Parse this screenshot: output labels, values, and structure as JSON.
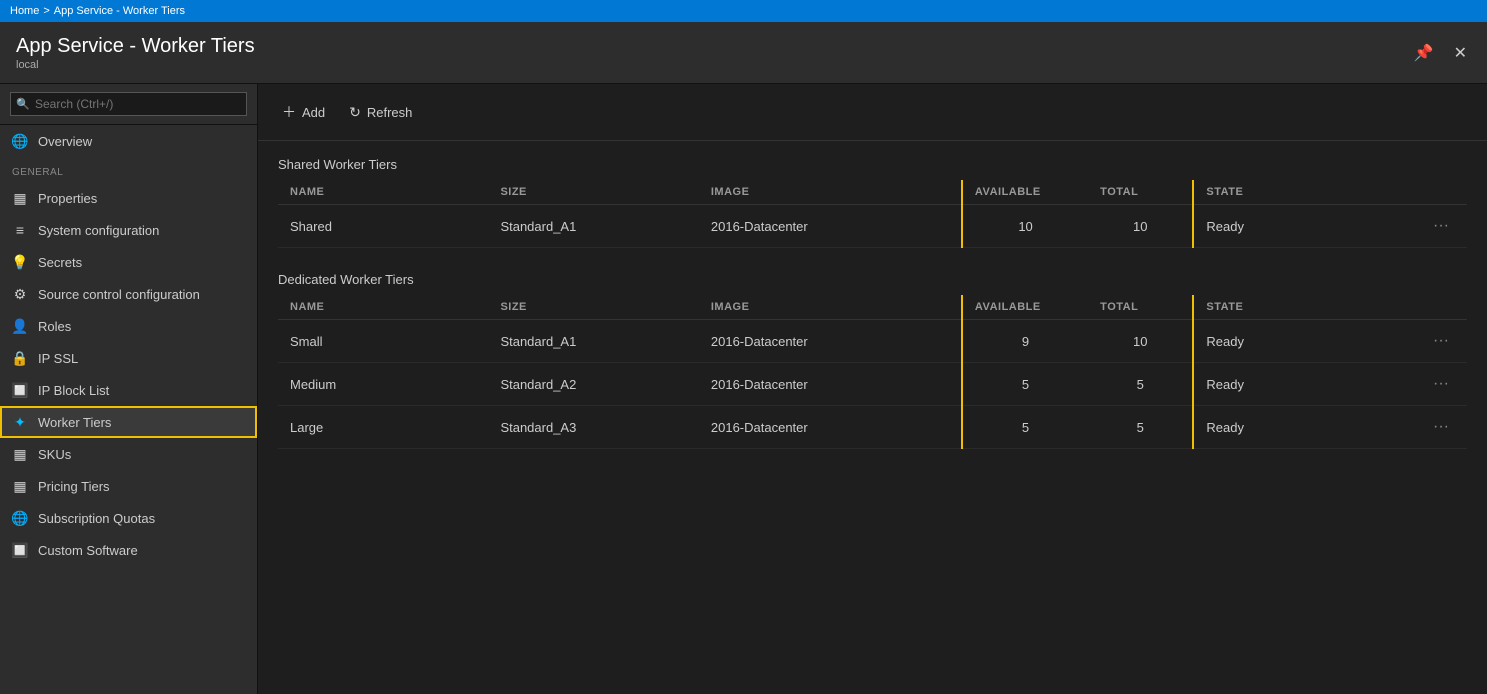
{
  "topbar": {
    "home": "Home",
    "separator": ">",
    "current": "App Service - Worker Tiers"
  },
  "titlebar": {
    "title": "App Service - Worker Tiers",
    "subtitle": "local",
    "pin_label": "📌",
    "close_label": "✕"
  },
  "sidebar": {
    "search_placeholder": "Search (Ctrl+/)",
    "section_general": "GENERAL",
    "items": [
      {
        "id": "overview",
        "label": "Overview",
        "icon": "🌐"
      },
      {
        "id": "properties",
        "label": "Properties",
        "icon": "▦"
      },
      {
        "id": "system-configuration",
        "label": "System configuration",
        "icon": "≡"
      },
      {
        "id": "secrets",
        "label": "Secrets",
        "icon": "💡"
      },
      {
        "id": "source-control",
        "label": "Source control configuration",
        "icon": "⚙"
      },
      {
        "id": "roles",
        "label": "Roles",
        "icon": "👤"
      },
      {
        "id": "ip-ssl",
        "label": "IP SSL",
        "icon": "🔒"
      },
      {
        "id": "ip-block-list",
        "label": "IP Block List",
        "icon": "🔲"
      },
      {
        "id": "worker-tiers",
        "label": "Worker Tiers",
        "icon": "✦",
        "active": true
      },
      {
        "id": "skus",
        "label": "SKUs",
        "icon": "▦"
      },
      {
        "id": "pricing-tiers",
        "label": "Pricing Tiers",
        "icon": "▦"
      },
      {
        "id": "subscription-quotas",
        "label": "Subscription Quotas",
        "icon": "🌐"
      },
      {
        "id": "custom-software",
        "label": "Custom Software",
        "icon": "🔲"
      }
    ]
  },
  "toolbar": {
    "add_label": "Add",
    "refresh_label": "Refresh"
  },
  "shared_section": {
    "title": "Shared Worker Tiers",
    "columns": {
      "name": "NAME",
      "size": "SIZE",
      "image": "IMAGE",
      "available": "AVAILABLE",
      "total": "TOTAL",
      "state": "STATE"
    },
    "rows": [
      {
        "name": "Shared",
        "size": "Standard_A1",
        "image": "2016-Datacenter",
        "available": "10",
        "total": "10",
        "state": "Ready"
      }
    ]
  },
  "dedicated_section": {
    "title": "Dedicated Worker Tiers",
    "columns": {
      "name": "NAME",
      "size": "SIZE",
      "image": "IMAGE",
      "available": "AVAILABLE",
      "total": "TOTAL",
      "state": "STATE"
    },
    "rows": [
      {
        "name": "Small",
        "size": "Standard_A1",
        "image": "2016-Datacenter",
        "available": "9",
        "total": "10",
        "state": "Ready"
      },
      {
        "name": "Medium",
        "size": "Standard_A2",
        "image": "2016-Datacenter",
        "available": "5",
        "total": "5",
        "state": "Ready"
      },
      {
        "name": "Large",
        "size": "Standard_A3",
        "image": "2016-Datacenter",
        "available": "5",
        "total": "5",
        "state": "Ready"
      }
    ]
  },
  "colors": {
    "highlight": "#f0c000",
    "active_bg": "#3a3a3a",
    "border": "#333"
  }
}
